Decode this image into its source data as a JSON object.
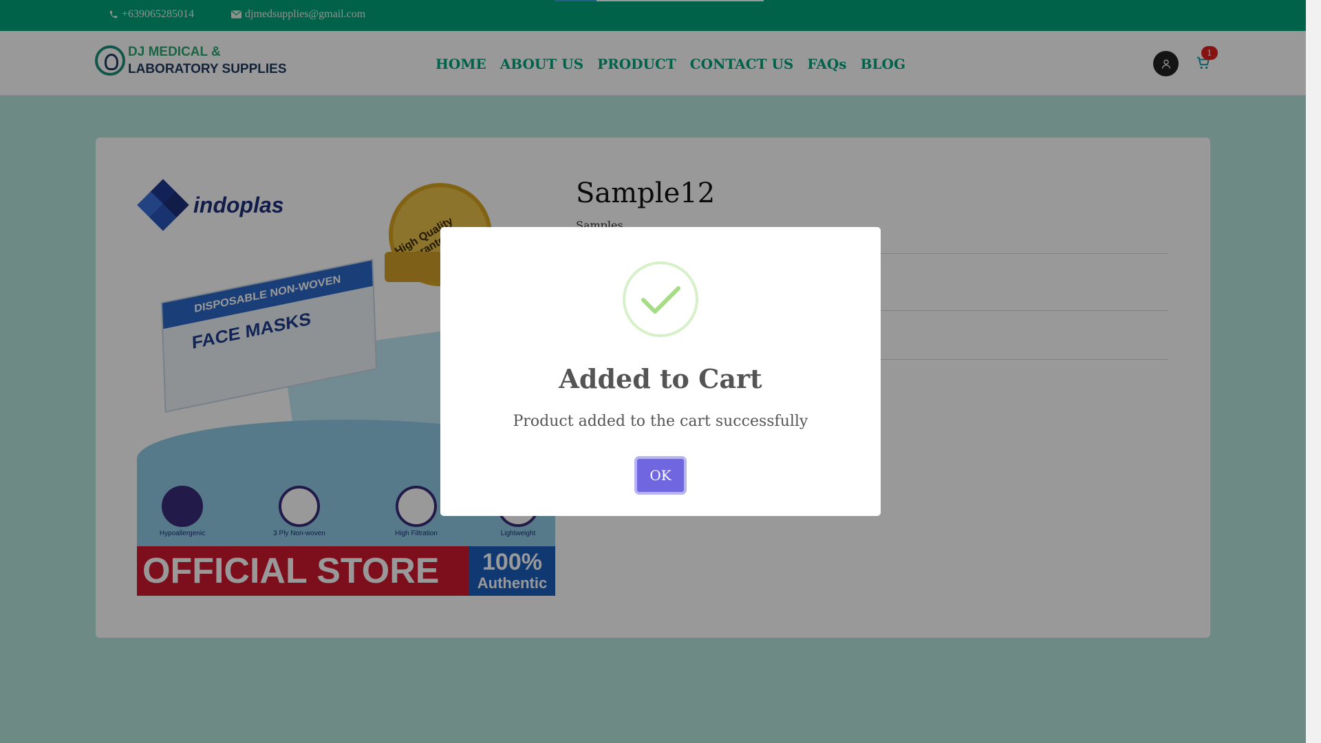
{
  "topbar": {
    "phone": "+639065285014",
    "email": "djmedsupplies@gmail.com",
    "phone_icon": "phone-icon",
    "email_icon": "envelope-icon",
    "loading_progress": 0.2
  },
  "header": {
    "logo": {
      "line1": "DJ MEDICAL &",
      "line2": "LABORATORY SUPPLIES"
    },
    "nav": [
      {
        "label": "HOME"
      },
      {
        "label": "ABOUT US"
      },
      {
        "label": "PRODUCT"
      },
      {
        "label": "CONTACT US"
      },
      {
        "label": "FAQs"
      },
      {
        "label": "BLOG"
      }
    ],
    "user_icon": "user-icon",
    "cart_icon": "cart-icon",
    "cart_count": "1"
  },
  "product": {
    "title": "Sample12",
    "category": "Samples",
    "image": {
      "brand": "indoplas",
      "seal_text": "High Quality Guarantee",
      "box_stripe": "DISPOSABLE NON-WOVEN",
      "box_title": "FACE MASKS",
      "features": [
        "Hypoallergenic",
        "3 Ply Non-woven",
        "High Filtration",
        "Lightweight"
      ],
      "banner": "OFFICIAL STORE",
      "badge_big": "100%",
      "badge_small": "Authentic"
    }
  },
  "modal": {
    "icon": "checkmark-icon",
    "title": "Added to Cart",
    "message": "Product added to the cart successfully",
    "ok_label": "OK"
  },
  "colors": {
    "brand_green": "#00a37a",
    "modal_button": "#7066e0",
    "success": "#a5dc86",
    "badge": "#e02020"
  }
}
